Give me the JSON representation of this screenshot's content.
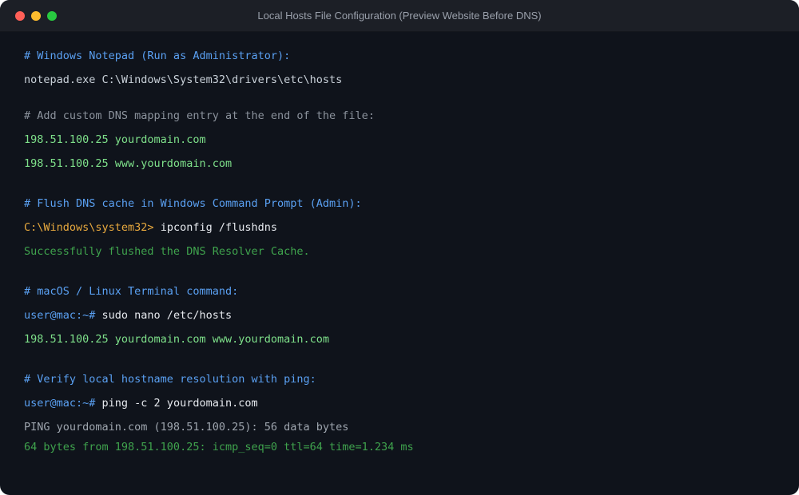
{
  "window": {
    "title": "Local Hosts File Configuration (Preview Website Before DNS)"
  },
  "colors": {
    "background": "#0f131b",
    "titlebar": "#1c1f26",
    "comment": "#5aa0f2",
    "entry": "#7ee08a",
    "success": "#3fa34d",
    "prompt_windows": "#e8a93e"
  },
  "terminal": {
    "windows_comment": "# Windows Notepad (Run as Administrator):",
    "windows_command": "notepad.exe C:\\Windows\\System32\\drivers\\etc\\hosts",
    "add_comment": "# Add custom DNS mapping entry at the end of the file:",
    "entry_1": "198.51.100.25 yourdomain.com",
    "entry_2": "198.51.100.25 www.yourdomain.com",
    "flush_comment": "# Flush DNS cache in Windows Command Prompt (Admin):",
    "flush_prompt": "C:\\Windows\\system32>",
    "flush_command": " ipconfig /flushdns",
    "flush_output": "Successfully flushed the DNS Resolver Cache.",
    "unix_comment": "# macOS / Linux Terminal command:",
    "unix_prompt_1": "user@mac:~#",
    "unix_command_1": " sudo nano /etc/hosts",
    "unix_entry": "198.51.100.25 yourdomain.com www.yourdomain.com",
    "verify_comment": "# Verify local hostname resolution with ping:",
    "unix_prompt_2": "user@mac:~#",
    "unix_command_2": " ping -c 2 yourdomain.com",
    "ping_header": "PING yourdomain.com (198.51.100.25): 56 data bytes",
    "ping_reply": "64 bytes from 198.51.100.25: icmp_seq=0 ttl=64 time=1.234 ms"
  }
}
